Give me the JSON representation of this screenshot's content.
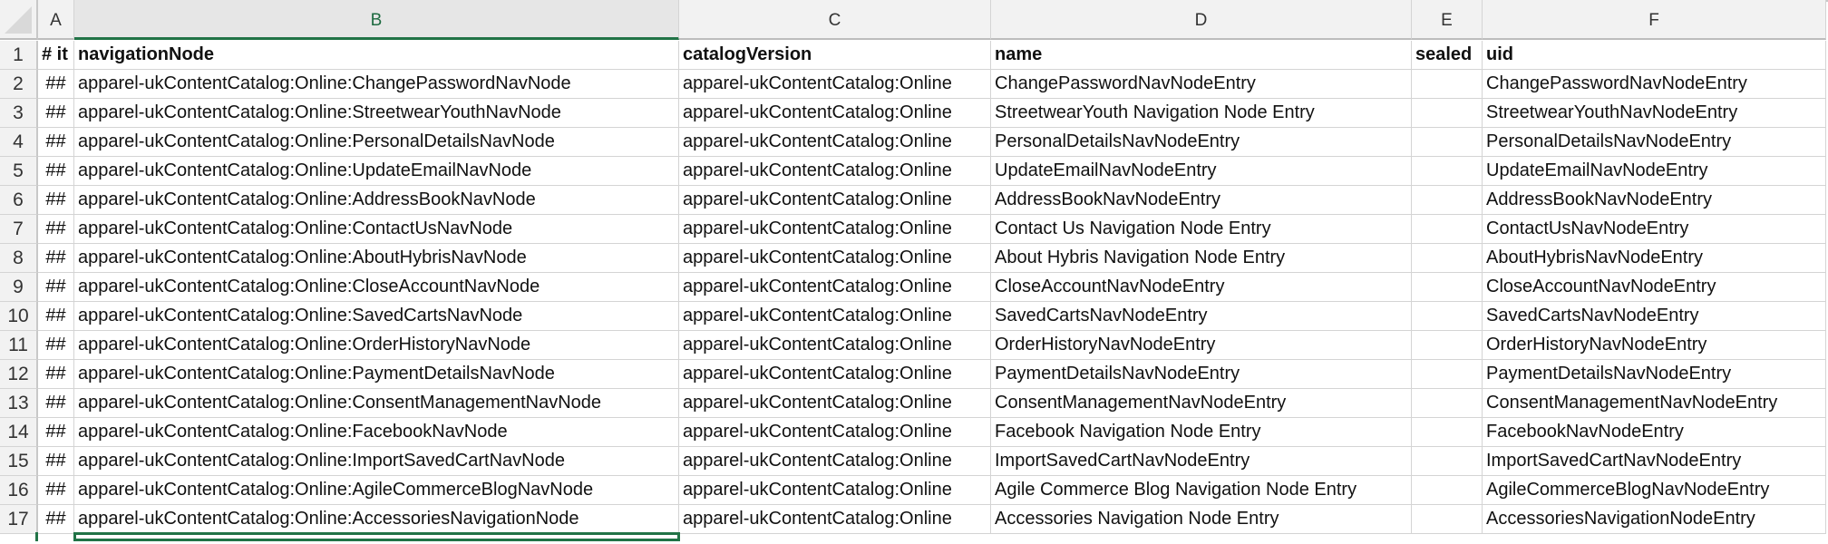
{
  "sheet": {
    "columns": [
      "A",
      "B",
      "C",
      "D",
      "E",
      "F"
    ],
    "selected_column": "B",
    "header_row": {
      "row_number": "1",
      "cells": [
        "# it",
        "navigationNode",
        "catalogVersion",
        "name",
        "sealed",
        "uid"
      ]
    },
    "rows": [
      {
        "n": "2",
        "a": "##",
        "b": "apparel-ukContentCatalog:Online:ChangePasswordNavNode",
        "c": "apparel-ukContentCatalog:Online",
        "d": "ChangePasswordNavNodeEntry",
        "e": "",
        "f": "ChangePasswordNavNodeEntry"
      },
      {
        "n": "3",
        "a": "##",
        "b": "apparel-ukContentCatalog:Online:StreetwearYouthNavNode",
        "c": "apparel-ukContentCatalog:Online",
        "d": "StreetwearYouth Navigation Node Entry",
        "e": "",
        "f": "StreetwearYouthNavNodeEntry"
      },
      {
        "n": "4",
        "a": "##",
        "b": "apparel-ukContentCatalog:Online:PersonalDetailsNavNode",
        "c": "apparel-ukContentCatalog:Online",
        "d": "PersonalDetailsNavNodeEntry",
        "e": "",
        "f": "PersonalDetailsNavNodeEntry"
      },
      {
        "n": "5",
        "a": "##",
        "b": "apparel-ukContentCatalog:Online:UpdateEmailNavNode",
        "c": "apparel-ukContentCatalog:Online",
        "d": "UpdateEmailNavNodeEntry",
        "e": "",
        "f": "UpdateEmailNavNodeEntry"
      },
      {
        "n": "6",
        "a": "##",
        "b": "apparel-ukContentCatalog:Online:AddressBookNavNode",
        "c": "apparel-ukContentCatalog:Online",
        "d": "AddressBookNavNodeEntry",
        "e": "",
        "f": "AddressBookNavNodeEntry"
      },
      {
        "n": "7",
        "a": "##",
        "b": "apparel-ukContentCatalog:Online:ContactUsNavNode",
        "c": "apparel-ukContentCatalog:Online",
        "d": "Contact Us Navigation Node Entry",
        "e": "",
        "f": "ContactUsNavNodeEntry"
      },
      {
        "n": "8",
        "a": "##",
        "b": "apparel-ukContentCatalog:Online:AboutHybrisNavNode",
        "c": "apparel-ukContentCatalog:Online",
        "d": "About Hybris Navigation Node Entry",
        "e": "",
        "f": "AboutHybrisNavNodeEntry"
      },
      {
        "n": "9",
        "a": "##",
        "b": "apparel-ukContentCatalog:Online:CloseAccountNavNode",
        "c": "apparel-ukContentCatalog:Online",
        "d": "CloseAccountNavNodeEntry",
        "e": "",
        "f": "CloseAccountNavNodeEntry"
      },
      {
        "n": "10",
        "a": "##",
        "b": "apparel-ukContentCatalog:Online:SavedCartsNavNode",
        "c": "apparel-ukContentCatalog:Online",
        "d": "SavedCartsNavNodeEntry",
        "e": "",
        "f": "SavedCartsNavNodeEntry"
      },
      {
        "n": "11",
        "a": "##",
        "b": "apparel-ukContentCatalog:Online:OrderHistoryNavNode",
        "c": "apparel-ukContentCatalog:Online",
        "d": "OrderHistoryNavNodeEntry",
        "e": "",
        "f": "OrderHistoryNavNodeEntry"
      },
      {
        "n": "12",
        "a": "##",
        "b": "apparel-ukContentCatalog:Online:PaymentDetailsNavNode",
        "c": "apparel-ukContentCatalog:Online",
        "d": "PaymentDetailsNavNodeEntry",
        "e": "",
        "f": "PaymentDetailsNavNodeEntry"
      },
      {
        "n": "13",
        "a": "##",
        "b": "apparel-ukContentCatalog:Online:ConsentManagementNavNode",
        "c": "apparel-ukContentCatalog:Online",
        "d": "ConsentManagementNavNodeEntry",
        "e": "",
        "f": "ConsentManagementNavNodeEntry"
      },
      {
        "n": "14",
        "a": "##",
        "b": "apparel-ukContentCatalog:Online:FacebookNavNode",
        "c": "apparel-ukContentCatalog:Online",
        "d": "Facebook Navigation Node Entry",
        "e": "",
        "f": "FacebookNavNodeEntry"
      },
      {
        "n": "15",
        "a": "##",
        "b": "apparel-ukContentCatalog:Online:ImportSavedCartNavNode",
        "c": "apparel-ukContentCatalog:Online",
        "d": "ImportSavedCartNavNodeEntry",
        "e": "",
        "f": "ImportSavedCartNavNodeEntry"
      },
      {
        "n": "16",
        "a": "##",
        "b": "apparel-ukContentCatalog:Online:AgileCommerceBlogNavNode",
        "c": "apparel-ukContentCatalog:Online",
        "d": "Agile Commerce Blog Navigation Node Entry",
        "e": "",
        "f": "AgileCommerceBlogNavNodeEntry"
      },
      {
        "n": "17",
        "a": "##",
        "b": "apparel-ukContentCatalog:Online:AccessoriesNavigationNode",
        "c": "apparel-ukContentCatalog:Online",
        "d": "Accessories Navigation Node Entry",
        "e": "",
        "f": "AccessoriesNavigationNodeEntry"
      }
    ]
  },
  "colors": {
    "selection": "#217346",
    "header_bg": "#f2f2f2",
    "gridline": "#d4d4d4"
  }
}
